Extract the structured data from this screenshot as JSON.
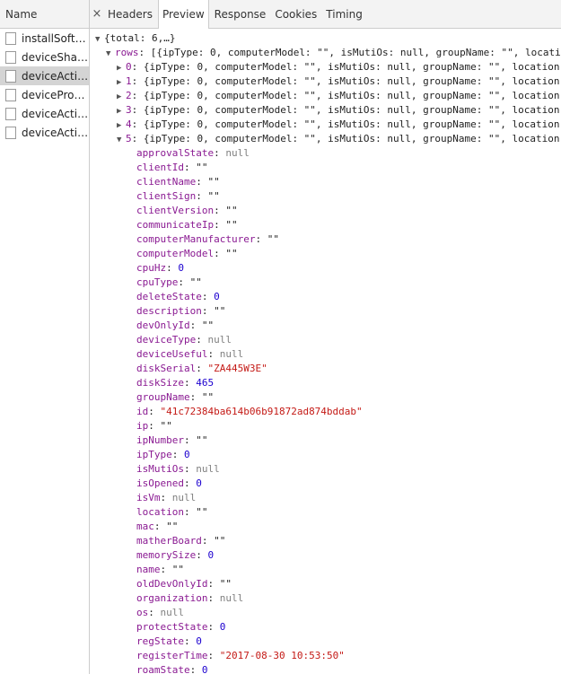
{
  "left": {
    "header": "Name",
    "files": [
      {
        "name": "installSoftA...",
        "selected": false
      },
      {
        "name": "deviceShar...",
        "selected": false
      },
      {
        "name": "deviceActio...",
        "selected": true
      },
      {
        "name": "deviceProd...",
        "selected": false
      },
      {
        "name": "deviceActio...",
        "selected": false
      },
      {
        "name": "deviceActio...",
        "selected": false
      }
    ]
  },
  "tabs": [
    {
      "label": "Headers",
      "active": false
    },
    {
      "label": "Preview",
      "active": true
    },
    {
      "label": "Response",
      "active": false
    },
    {
      "label": "Cookies",
      "active": false
    },
    {
      "label": "Timing",
      "active": false
    }
  ],
  "close_symbol": "×",
  "preview": {
    "root_summary": "{total: 6,…}",
    "rows_key": "rows",
    "rows_summary": "[{ipType: 0, computerModel: \"\", isMutiOs: null, groupName: \"\", location: \"\", …},…]",
    "row_summary": "{ipType: 0, computerModel: \"\", isMutiOs: null, groupName: \"\", location: \"\", …}",
    "collapsed_rows": [
      "0",
      "1",
      "2",
      "3",
      "4"
    ],
    "expanded_row": "5",
    "fields": [
      {
        "key": "approvalState",
        "value": "null",
        "type": "null"
      },
      {
        "key": "clientId",
        "value": "\"\"",
        "type": "plain"
      },
      {
        "key": "clientName",
        "value": "\"\"",
        "type": "plain"
      },
      {
        "key": "clientSign",
        "value": "\"\"",
        "type": "plain"
      },
      {
        "key": "clientVersion",
        "value": "\"\"",
        "type": "plain"
      },
      {
        "key": "communicateIp",
        "value": "\"\"",
        "type": "plain"
      },
      {
        "key": "computerManufacturer",
        "value": "\"\"",
        "type": "plain"
      },
      {
        "key": "computerModel",
        "value": "\"\"",
        "type": "plain"
      },
      {
        "key": "cpuHz",
        "value": "0",
        "type": "num"
      },
      {
        "key": "cpuType",
        "value": "\"\"",
        "type": "plain"
      },
      {
        "key": "deleteState",
        "value": "0",
        "type": "num"
      },
      {
        "key": "description",
        "value": "\"\"",
        "type": "plain"
      },
      {
        "key": "devOnlyId",
        "value": "\"\"",
        "type": "plain"
      },
      {
        "key": "deviceType",
        "value": "null",
        "type": "null"
      },
      {
        "key": "deviceUseful",
        "value": "null",
        "type": "null"
      },
      {
        "key": "diskSerial",
        "value": "\"ZA445W3E\"",
        "type": "str"
      },
      {
        "key": "diskSize",
        "value": "465",
        "type": "num"
      },
      {
        "key": "groupName",
        "value": "\"\"",
        "type": "plain"
      },
      {
        "key": "id",
        "value": "\"41c72384ba614b06b91872ad874bddab\"",
        "type": "str"
      },
      {
        "key": "ip",
        "value": "\"\"",
        "type": "plain"
      },
      {
        "key": "ipNumber",
        "value": "\"\"",
        "type": "plain"
      },
      {
        "key": "ipType",
        "value": "0",
        "type": "num"
      },
      {
        "key": "isMutiOs",
        "value": "null",
        "type": "null"
      },
      {
        "key": "isOpened",
        "value": "0",
        "type": "num"
      },
      {
        "key": "isVm",
        "value": "null",
        "type": "null"
      },
      {
        "key": "location",
        "value": "\"\"",
        "type": "plain"
      },
      {
        "key": "mac",
        "value": "\"\"",
        "type": "plain"
      },
      {
        "key": "matherBoard",
        "value": "\"\"",
        "type": "plain"
      },
      {
        "key": "memorySize",
        "value": "0",
        "type": "num"
      },
      {
        "key": "name",
        "value": "\"\"",
        "type": "plain"
      },
      {
        "key": "oldDevOnlyId",
        "value": "\"\"",
        "type": "plain"
      },
      {
        "key": "organization",
        "value": "null",
        "type": "null"
      },
      {
        "key": "os",
        "value": "null",
        "type": "null"
      },
      {
        "key": "protectState",
        "value": "0",
        "type": "num"
      },
      {
        "key": "regState",
        "value": "0",
        "type": "num"
      },
      {
        "key": "registerTime",
        "value": "\"2017-08-30 10:53:50\"",
        "type": "str"
      },
      {
        "key": "roamState",
        "value": "0",
        "type": "num"
      }
    ]
  }
}
